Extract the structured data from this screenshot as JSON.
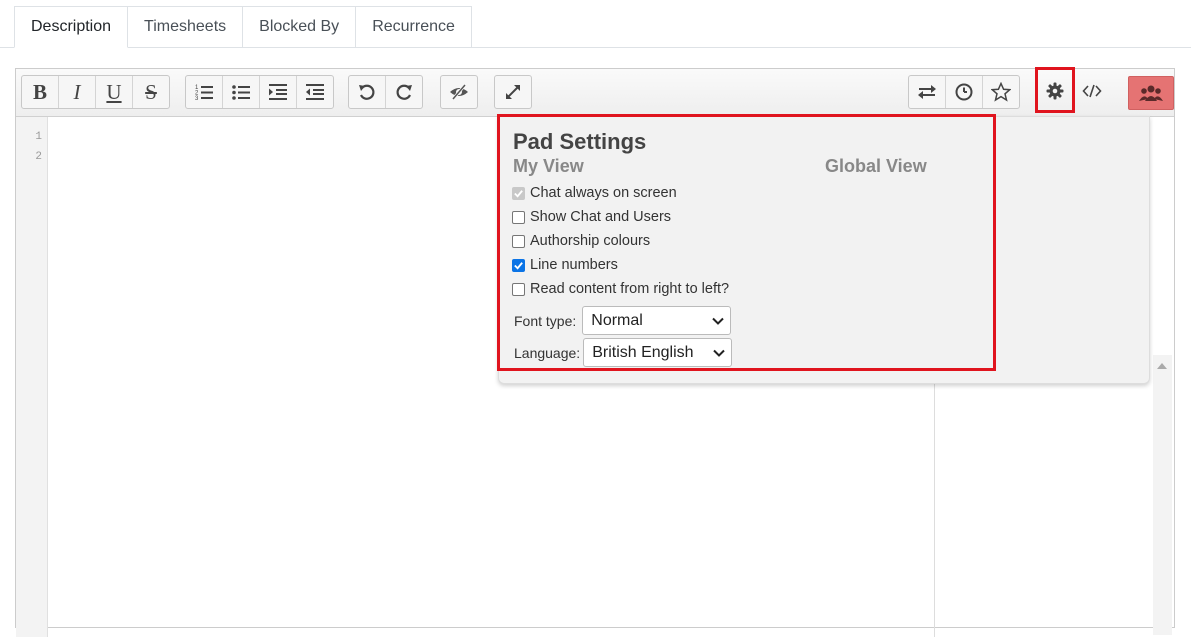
{
  "tabs": [
    {
      "label": "Description",
      "active": true
    },
    {
      "label": "Timesheets",
      "active": false
    },
    {
      "label": "Blocked By",
      "active": false
    },
    {
      "label": "Recurrence",
      "active": false
    }
  ],
  "toolbar": {
    "bold": "B",
    "italic": "I",
    "underline": "U",
    "strike": "S"
  },
  "editor": {
    "line_numbers": [
      "1",
      "2"
    ]
  },
  "pad_settings": {
    "title": "Pad Settings",
    "my_view": "My View",
    "global_view": "Global View",
    "options": [
      {
        "label": "Chat always on screen",
        "checked": true,
        "disabled": true
      },
      {
        "label": "Show Chat and Users",
        "checked": false,
        "disabled": false
      },
      {
        "label": "Authorship colours",
        "checked": false,
        "disabled": false
      },
      {
        "label": "Line numbers",
        "checked": true,
        "disabled": false
      },
      {
        "label": "Read content from right to left?",
        "checked": false,
        "disabled": false
      }
    ],
    "font_type_label": "Font type:",
    "font_type_value": "Normal",
    "language_label": "Language:",
    "language_value": "British English"
  },
  "colors": {
    "highlight": "#e0141e",
    "user_button": "#e57373",
    "checkbox_checked": "#0b74e6"
  }
}
